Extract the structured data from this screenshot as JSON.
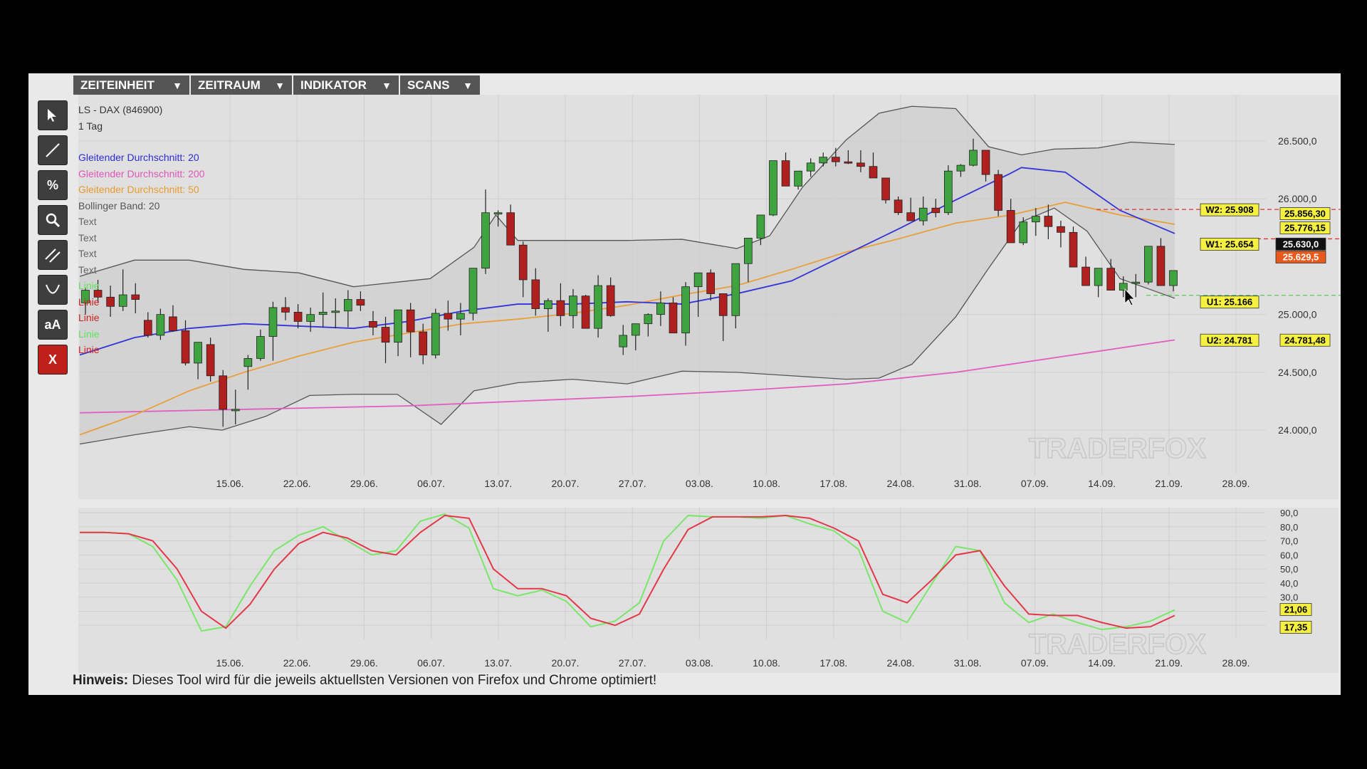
{
  "menu": [
    {
      "label": "ZEITEINHEIT",
      "arrow": "▼"
    },
    {
      "label": "ZEITRAUM",
      "arrow": "▼"
    },
    {
      "label": "INDIKATOR",
      "arrow": "▼"
    },
    {
      "label": "SCANS",
      "arrow": "▼"
    }
  ],
  "tools": [
    {
      "name": "cursor-tool",
      "icon": "cursor-icon"
    },
    {
      "name": "line-tool",
      "icon": "line-icon"
    },
    {
      "name": "percent-tool",
      "icon": "percent-icon",
      "glyph": "%"
    },
    {
      "name": "zoom-tool",
      "icon": "magnifier-icon"
    },
    {
      "name": "parallel-lines-tool",
      "icon": "parallel-lines-icon"
    },
    {
      "name": "curve-tool",
      "icon": "curve-icon"
    },
    {
      "name": "text-tool",
      "icon": "text-size-icon",
      "glyph": "aA"
    },
    {
      "name": "delete-tool",
      "icon": "delete-icon",
      "glyph": "X"
    }
  ],
  "legend": {
    "instrument": "LS - DAX (846900)",
    "period": "1 Tag",
    "items": [
      {
        "text": "Gleitender Durchschnitt: 20",
        "color": "#2c2cd6"
      },
      {
        "text": "Gleitender Durchschnitt: 200",
        "color": "#e056b8"
      },
      {
        "text": "Gleitender Durchschnitt: 50",
        "color": "#e89a2e"
      },
      {
        "text": "Bollinger Band: 20",
        "color": "#555555"
      },
      {
        "text": "Text",
        "color": "#666666"
      },
      {
        "text": "Text",
        "color": "#666666"
      },
      {
        "text": "Text",
        "color": "#666666"
      },
      {
        "text": "Text",
        "color": "#666666"
      },
      {
        "text": "Linie",
        "color": "#5ee35e"
      },
      {
        "text": "Linie",
        "color": "#d11f1f"
      },
      {
        "text": "Linie",
        "color": "#d11f1f"
      },
      {
        "text": "Linie",
        "color": "#5ee35e"
      },
      {
        "text": "Linie",
        "color": "#d11f1f"
      }
    ]
  },
  "watermark": "TRADERFOX",
  "hint": {
    "label": "Hinweis:",
    "text": " Dieses Tool wird für die jeweils aktuellsten Versionen von Firefox und Chrome optimiert!"
  },
  "colors": {
    "up": "#3fa33f",
    "down": "#b0201f",
    "ma20": "#3434d8",
    "ma200": "#e35cc0",
    "ma50": "#e9a03c",
    "stoch_k": "#7ae66a",
    "stoch_d": "#e2384a"
  },
  "chart_data": [
    {
      "type": "candlestick",
      "title": "LS - DAX (846900)",
      "ylim": [
        23650,
        26900
      ],
      "y_ticks": [
        "24.000,0",
        "24.500,0",
        "25.000,0",
        "26.000,0",
        "26.500,0"
      ],
      "y_tick_values": [
        24000,
        24500,
        25000,
        26000,
        26500
      ],
      "x_ticks": [
        "15.06.",
        "22.06.",
        "29.06.",
        "06.07.",
        "13.07.",
        "20.07.",
        "27.07.",
        "03.08.",
        "10.08.",
        "17.08.",
        "24.08.",
        "31.08.",
        "07.09.",
        "14.09.",
        "21.09.",
        "28.09."
      ],
      "ohlc": [
        [
          25100,
          25230,
          25000,
          25210
        ],
        [
          25210,
          25300,
          25100,
          25150
        ],
        [
          25150,
          25250,
          24980,
          25070
        ],
        [
          25070,
          25390,
          25030,
          25170
        ],
        [
          25170,
          25270,
          25010,
          25130
        ],
        [
          24950,
          25020,
          24800,
          24820
        ],
        [
          24820,
          25050,
          24780,
          25000
        ],
        [
          24980,
          25080,
          24850,
          24860
        ],
        [
          24860,
          24950,
          24560,
          24580
        ],
        [
          24580,
          24740,
          24440,
          24760
        ],
        [
          24740,
          24800,
          24420,
          24470
        ],
        [
          24470,
          24520,
          24030,
          24180
        ],
        [
          24180,
          24350,
          24050,
          24180
        ],
        [
          24550,
          24650,
          24350,
          24620
        ],
        [
          24620,
          24870,
          24600,
          24810
        ],
        [
          24810,
          25110,
          24600,
          25060
        ],
        [
          25060,
          25150,
          24950,
          25020
        ],
        [
          25020,
          25090,
          24880,
          24940
        ],
        [
          24940,
          25060,
          24850,
          25000
        ],
        [
          25000,
          25190,
          24890,
          25020
        ],
        [
          25020,
          25140,
          24880,
          25030
        ],
        [
          25030,
          25210,
          24890,
          25130
        ],
        [
          25130,
          25200,
          25030,
          25080
        ],
        [
          24940,
          25030,
          24820,
          24890
        ],
        [
          24890,
          24980,
          24580,
          24760
        ],
        [
          24760,
          25000,
          24640,
          25040
        ],
        [
          25040,
          25100,
          24630,
          24850
        ],
        [
          24850,
          24920,
          24570,
          24650
        ],
        [
          24650,
          25050,
          24620,
          25010
        ],
        [
          25010,
          25120,
          24860,
          24960
        ],
        [
          24960,
          25100,
          24820,
          25010
        ],
        [
          25010,
          25400,
          24950,
          25400
        ],
        [
          25400,
          26080,
          25350,
          25880
        ],
        [
          25880,
          25900,
          25760,
          25880
        ],
        [
          25880,
          25950,
          25780,
          25600
        ],
        [
          25600,
          25630,
          25150,
          25300
        ],
        [
          25300,
          25400,
          24990,
          25050
        ],
        [
          25050,
          25140,
          24850,
          25120
        ],
        [
          25120,
          25270,
          24900,
          24990
        ],
        [
          24990,
          25220,
          24880,
          25160
        ],
        [
          25160,
          25170,
          24880,
          24880
        ],
        [
          24880,
          25340,
          24800,
          25250
        ],
        [
          25250,
          25320,
          24980,
          24990
        ],
        [
          24720,
          24910,
          24650,
          24820
        ],
        [
          24820,
          24900,
          24690,
          24920
        ],
        [
          24920,
          25010,
          24810,
          25000
        ],
        [
          25000,
          25200,
          24900,
          25100
        ],
        [
          25100,
          25150,
          24950,
          24840
        ],
        [
          24840,
          25280,
          24730,
          25240
        ],
        [
          25240,
          25360,
          24980,
          25360
        ],
        [
          25360,
          25390,
          25120,
          25180
        ],
        [
          25180,
          25180,
          24770,
          24990
        ],
        [
          24990,
          25060,
          24880,
          25440
        ],
        [
          25440,
          25620,
          25280,
          25660
        ],
        [
          25660,
          25780,
          25600,
          25860
        ],
        [
          25860,
          26330,
          25850,
          26330
        ],
        [
          26330,
          26400,
          26150,
          26110
        ],
        [
          26110,
          26200,
          26080,
          26240
        ],
        [
          26240,
          26350,
          26190,
          26310
        ],
        [
          26310,
          26400,
          26280,
          26360
        ],
        [
          26360,
          26440,
          26280,
          26320
        ],
        [
          26320,
          26420,
          26300,
          26310
        ],
        [
          26310,
          26420,
          26230,
          26280
        ],
        [
          26280,
          26400,
          26250,
          26180
        ],
        [
          26180,
          26180,
          25960,
          25990
        ],
        [
          25990,
          26020,
          25860,
          25880
        ],
        [
          25880,
          26010,
          25840,
          25810
        ],
        [
          25810,
          26020,
          25770,
          25920
        ],
        [
          25920,
          26000,
          25840,
          25880
        ],
        [
          25880,
          26290,
          25860,
          26240
        ],
        [
          26240,
          26300,
          26190,
          26290
        ],
        [
          26290,
          26520,
          26280,
          26420
        ],
        [
          26420,
          26420,
          26150,
          26210
        ],
        [
          26210,
          26250,
          25850,
          25900
        ],
        [
          25900,
          26000,
          25700,
          25620
        ],
        [
          25620,
          25840,
          25600,
          25800
        ],
        [
          25800,
          25920,
          25680,
          25850
        ],
        [
          25850,
          25950,
          25650,
          25760
        ],
        [
          25760,
          25810,
          25580,
          25710
        ],
        [
          25710,
          25760,
          25440,
          25410
        ],
        [
          25410,
          25500,
          25270,
          25250
        ],
        [
          25250,
          25300,
          25150,
          25400
        ],
        [
          25400,
          25480,
          25360,
          25210
        ],
        [
          25210,
          25330,
          25150,
          25270
        ],
        [
          25270,
          25350,
          25150,
          25280
        ],
        [
          25280,
          25580,
          25260,
          25590
        ],
        [
          25590,
          25660,
          25300,
          25250
        ],
        [
          25250,
          25330,
          25200,
          25380
        ]
      ],
      "ma20_points": [
        [
          0.0,
          24650
        ],
        [
          0.05,
          24800
        ],
        [
          0.1,
          24880
        ],
        [
          0.15,
          24920
        ],
        [
          0.2,
          24900
        ],
        [
          0.25,
          24880
        ],
        [
          0.3,
          24940
        ],
        [
          0.35,
          25030
        ],
        [
          0.4,
          25090
        ],
        [
          0.45,
          25090
        ],
        [
          0.5,
          25110
        ],
        [
          0.55,
          25090
        ],
        [
          0.6,
          25180
        ],
        [
          0.65,
          25290
        ],
        [
          0.7,
          25520
        ],
        [
          0.75,
          25750
        ],
        [
          0.8,
          25990
        ],
        [
          0.85,
          26220
        ],
        [
          0.86,
          26270
        ],
        [
          0.9,
          26230
        ],
        [
          0.95,
          25900
        ],
        [
          1.0,
          25700
        ]
      ],
      "ma50_points": [
        [
          0.0,
          23960
        ],
        [
          0.05,
          24130
        ],
        [
          0.1,
          24340
        ],
        [
          0.15,
          24500
        ],
        [
          0.2,
          24640
        ],
        [
          0.25,
          24760
        ],
        [
          0.3,
          24840
        ],
        [
          0.35,
          24920
        ],
        [
          0.4,
          24960
        ],
        [
          0.45,
          25010
        ],
        [
          0.5,
          25080
        ],
        [
          0.55,
          25170
        ],
        [
          0.6,
          25250
        ],
        [
          0.65,
          25390
        ],
        [
          0.7,
          25540
        ],
        [
          0.75,
          25660
        ],
        [
          0.8,
          25790
        ],
        [
          0.85,
          25860
        ],
        [
          0.9,
          25970
        ],
        [
          0.95,
          25860
        ],
        [
          1.0,
          25780
        ]
      ],
      "ma200_points": [
        [
          0.0,
          24150
        ],
        [
          0.1,
          24170
        ],
        [
          0.2,
          24190
        ],
        [
          0.3,
          24210
        ],
        [
          0.4,
          24250
        ],
        [
          0.5,
          24290
        ],
        [
          0.6,
          24340
        ],
        [
          0.7,
          24400
        ],
        [
          0.8,
          24500
        ],
        [
          0.9,
          24640
        ],
        [
          1.0,
          24780
        ]
      ],
      "boll_upper": [
        [
          0.0,
          25330
        ],
        [
          0.05,
          25470
        ],
        [
          0.1,
          25470
        ],
        [
          0.15,
          25390
        ],
        [
          0.2,
          25360
        ],
        [
          0.25,
          25240
        ],
        [
          0.3,
          25290
        ],
        [
          0.32,
          25310
        ],
        [
          0.36,
          25580
        ],
        [
          0.38,
          25860
        ],
        [
          0.4,
          25640
        ],
        [
          0.45,
          25640
        ],
        [
          0.5,
          25640
        ],
        [
          0.55,
          25650
        ],
        [
          0.6,
          25570
        ],
        [
          0.63,
          25680
        ],
        [
          0.66,
          26100
        ],
        [
          0.7,
          26510
        ],
        [
          0.73,
          26740
        ],
        [
          0.76,
          26800
        ],
        [
          0.8,
          26780
        ],
        [
          0.83,
          26450
        ],
        [
          0.86,
          26380
        ],
        [
          0.89,
          26430
        ],
        [
          0.93,
          26440
        ],
        [
          0.96,
          26490
        ],
        [
          1.0,
          26470
        ]
      ],
      "boll_lower": [
        [
          0.0,
          23880
        ],
        [
          0.05,
          23960
        ],
        [
          0.1,
          24030
        ],
        [
          0.13,
          24000
        ],
        [
          0.17,
          24120
        ],
        [
          0.21,
          24300
        ],
        [
          0.25,
          24310
        ],
        [
          0.29,
          24310
        ],
        [
          0.33,
          24050
        ],
        [
          0.36,
          24340
        ],
        [
          0.4,
          24410
        ],
        [
          0.45,
          24440
        ],
        [
          0.5,
          24400
        ],
        [
          0.55,
          24510
        ],
        [
          0.6,
          24500
        ],
        [
          0.65,
          24470
        ],
        [
          0.7,
          24440
        ],
        [
          0.73,
          24450
        ],
        [
          0.76,
          24570
        ],
        [
          0.8,
          24980
        ],
        [
          0.83,
          25400
        ],
        [
          0.86,
          25800
        ],
        [
          0.89,
          25920
        ],
        [
          0.92,
          25720
        ],
        [
          0.95,
          25310
        ],
        [
          1.0,
          25140
        ]
      ],
      "labels": {
        "w2": "W2: 25.908",
        "w1": "W1: 25.654",
        "u1": "U1: 25.166",
        "u2": "U2: 24.781",
        "price1": "25.856,30",
        "price2": "25.776,15",
        "price3": "25.630,0",
        "price4": "25.629,5",
        "price5": "24.781,48"
      }
    },
    {
      "type": "line",
      "title": "",
      "ylim": [
        0,
        90
      ],
      "y_ticks": [
        "10,0",
        "20,0",
        "30,0",
        "40,0",
        "50,0",
        "60,0",
        "70,0",
        "80,0",
        "90,0"
      ],
      "y_tick_values": [
        10,
        20,
        30,
        40,
        50,
        60,
        70,
        80,
        90
      ],
      "x_ticks": [
        "15.06.",
        "22.06.",
        "29.06.",
        "06.07.",
        "13.07.",
        "20.07.",
        "27.07.",
        "03.08.",
        "10.08.",
        "17.08.",
        "24.08.",
        "31.08.",
        "07.09.",
        "14.09.",
        "21.09.",
        "28.09."
      ],
      "series": [
        {
          "name": "",
          "values": [
            76,
            76,
            75,
            66,
            42,
            6,
            9,
            38,
            63,
            74,
            80,
            70,
            60,
            63,
            84,
            89,
            79,
            36,
            31,
            35,
            27,
            9,
            13,
            26,
            70,
            88,
            87,
            87,
            86,
            88,
            82,
            77,
            64,
            20,
            12,
            39,
            66,
            63,
            26,
            12,
            18,
            12,
            7,
            9,
            13,
            21
          ]
        },
        {
          "name": "",
          "values": [
            76,
            76,
            75,
            70,
            50,
            20,
            8,
            25,
            50,
            68,
            76,
            72,
            63,
            60,
            76,
            88,
            86,
            50,
            36,
            36,
            31,
            15,
            10,
            18,
            50,
            78,
            87,
            87,
            87,
            88,
            86,
            79,
            70,
            32,
            26,
            42,
            60,
            63,
            38,
            18,
            17,
            17,
            12,
            8,
            9,
            17
          ]
        }
      ],
      "value_labels": {
        "k": "21,06",
        "d": "17,35"
      }
    }
  ]
}
